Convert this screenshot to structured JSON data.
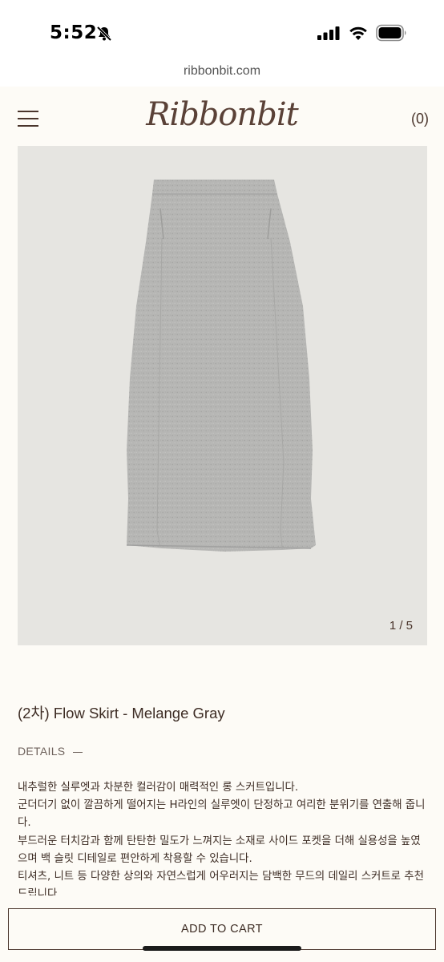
{
  "status_bar": {
    "time": "5:52",
    "icons": [
      "bell-slash-icon",
      "signal-icon",
      "wifi-icon",
      "battery-icon"
    ]
  },
  "browser": {
    "url": "ribbonbit.com"
  },
  "header": {
    "logo": "Ribbonbit",
    "cart_count": "(0)",
    "menu_icon": "hamburger-menu-icon"
  },
  "gallery": {
    "counter": "1 / 5"
  },
  "product": {
    "title": "(2차) Flow Skirt - Melange Gray",
    "details_label": "DETAILS",
    "description": [
      "내추럴한 실루엣과 차분한 컬러감이 매력적인 롱 스커트입니다.",
      "군더더기 없이 깔끔하게 떨어지는 H라인의 실루엣이 단정하고 여리한 분위기를 연출해 줍니다.",
      "부드러운 터치감과 함께 탄탄한 밀도가 느껴지는 소재로 사이드 포켓을 더해 실용성을 높였으며 백 슬릿 디테일로 편안하게 착용할 수 있습니다.",
      "티셔츠, 니트 등 다양한 상의와 자연스럽게 어우러지는 담백한 무드의 데일리 스커트로 추천 드립니다."
    ]
  },
  "actions": {
    "add_to_cart": "ADD TO CART"
  },
  "colors": {
    "background": "#fdfbf6",
    "brand_brown": "#5a4137",
    "image_bg": "#e6e5e1",
    "skirt_gray": "#b4b4b2"
  }
}
